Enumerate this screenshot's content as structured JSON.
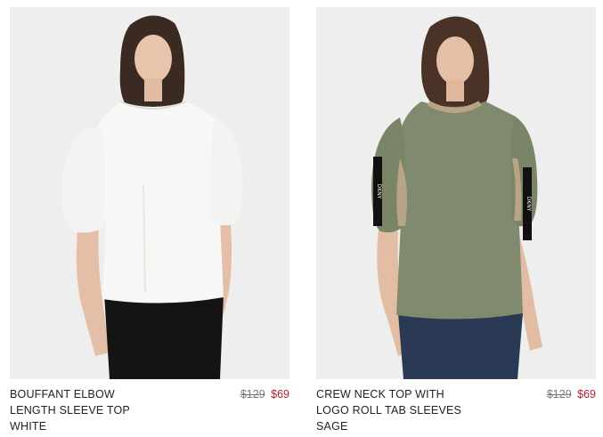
{
  "products": [
    {
      "name_lines": [
        "BOUFFANT ELBOW",
        "LENGTH SLEEVE TOP"
      ],
      "color": "WHITE",
      "original_price": "$129",
      "sale_price": "$69",
      "image_icon": "model-white-top-photo",
      "garment_color": "#f6f6f4"
    },
    {
      "name_lines": [
        "CREW NECK TOP WITH",
        "LOGO ROLL TAB SLEEVES"
      ],
      "color": "SAGE",
      "original_price": "$129",
      "sale_price": "$69",
      "image_icon": "model-sage-top-photo",
      "garment_color": "#7f8a6e",
      "tab_text": "DKNY"
    }
  ]
}
